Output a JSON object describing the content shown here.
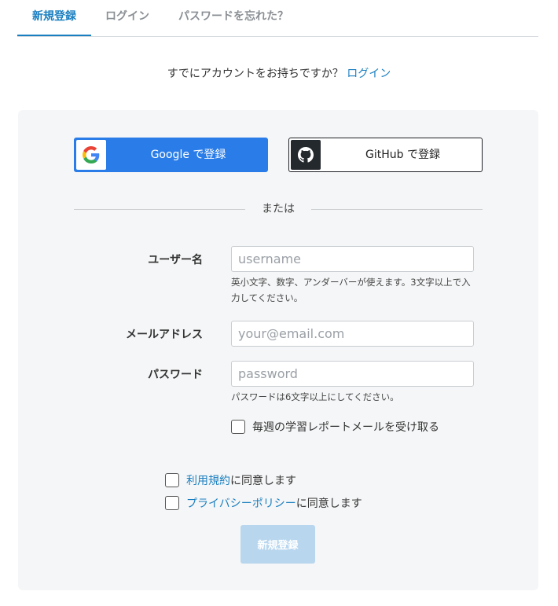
{
  "tabs": [
    {
      "label": "新規登録",
      "active": true
    },
    {
      "label": "ログイン",
      "active": false
    },
    {
      "label": "パスワードを忘れた？",
      "active": false
    }
  ],
  "subtitle": {
    "text": "すでにアカウントをお持ちですか？",
    "link": "ログイン"
  },
  "social": {
    "google": {
      "label": "Google で登録",
      "icon": "google-icon",
      "color": "#2a7de8"
    },
    "github": {
      "label": "GitHub で登録",
      "icon": "github-icon",
      "color": "#24292e"
    }
  },
  "divider_text": "または",
  "form": {
    "username": {
      "label": "ユーザー名",
      "placeholder": "username",
      "value": "",
      "help": "英小文字、数字、アンダーバーが使えます。3文字以上で入力してください。"
    },
    "email": {
      "label": "メールアドレス",
      "placeholder": "your@email.com",
      "value": ""
    },
    "password": {
      "label": "パスワード",
      "placeholder": "password",
      "value": "",
      "help": "パスワードは6文字以上にしてください。"
    },
    "weekly_report": {
      "label": "毎週の学習レポートメールを受け取る",
      "checked": false
    }
  },
  "agreements": {
    "terms": {
      "link": "利用規約",
      "suffix": "に同意します",
      "checked": false
    },
    "privacy": {
      "link": "プライバシーポリシー",
      "suffix": "に同意します",
      "checked": false
    }
  },
  "submit_label": "新規登録",
  "colors": {
    "accent": "#1a7fc0",
    "submit_disabled": "#b8d6ee",
    "panel_bg": "#f5f6f7"
  }
}
